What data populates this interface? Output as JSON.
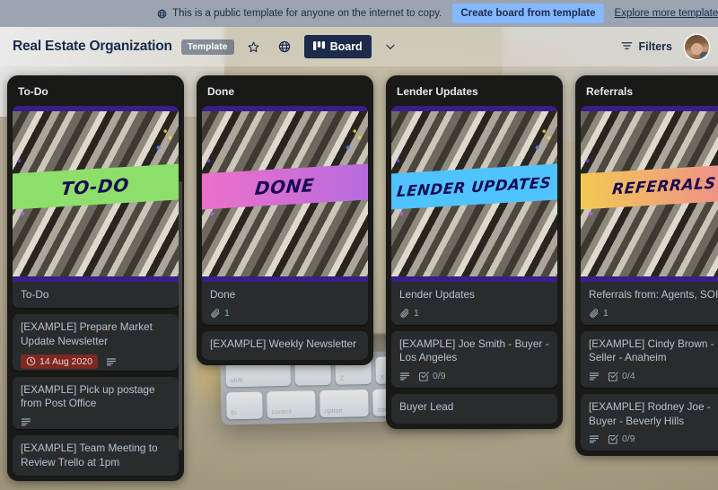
{
  "template_banner": {
    "globe_icon": "globe-icon",
    "message": "This is a public template for anyone on the internet to copy.",
    "cta_label": "Create board from template",
    "explore_label": "Explore more templates",
    "background_color": "#9aa5b1",
    "cta_color": "#85b8ff"
  },
  "board_header": {
    "title": "Real Estate Organization",
    "template_pill": "Template",
    "star_icon": "star-icon",
    "visibility_icon": "globe-icon",
    "view_button": {
      "icon": "board-icon",
      "label": "Board"
    },
    "view_caret_icon": "chevron-down-icon",
    "filters": {
      "icon": "filter-icon",
      "label": "Filters"
    },
    "avatar": "user-avatar"
  },
  "lists": [
    {
      "name": "To-Do",
      "cover_banner_text": "TO-DO",
      "banner_color_start": "#8ede6b",
      "banner_color_end": "#8ede6b",
      "cards": [
        {
          "has_cover": true,
          "title": "To-Do",
          "badges": [
            {
              "type": "attachment",
              "icon": "paperclip-icon",
              "value": "1"
            }
          ]
        },
        {
          "has_cover": false,
          "title": "[EXAMPLE] Prepare Market Update Newsletter",
          "badges": [
            {
              "type": "due-date",
              "icon": "clock-icon",
              "value": "14 Aug 2020"
            },
            {
              "type": "description",
              "icon": "description-icon",
              "value": ""
            }
          ]
        },
        {
          "has_cover": false,
          "title": "[EXAMPLE] Pick up postage from Post Office",
          "badges": [
            {
              "type": "description",
              "icon": "description-icon",
              "value": ""
            }
          ]
        },
        {
          "has_cover": false,
          "title": "[EXAMPLE] Team Meeting to Review Trello at 1pm",
          "badges": []
        }
      ]
    },
    {
      "name": "Done",
      "cover_banner_text": "DONE",
      "banner_color_start": "#f472c8",
      "banner_color_end": "#b06ae0",
      "cards": [
        {
          "has_cover": true,
          "title": "Done",
          "badges": [
            {
              "type": "attachment",
              "icon": "paperclip-icon",
              "value": "1"
            }
          ]
        },
        {
          "has_cover": false,
          "title": "[EXAMPLE] Weekly Newsletter",
          "badges": []
        }
      ]
    },
    {
      "name": "Lender Updates",
      "cover_banner_text": "LENDER UPDATES",
      "banner_color_start": "#4fc3ff",
      "banner_color_end": "#4fc3ff",
      "cards": [
        {
          "has_cover": true,
          "title": "Lender Updates",
          "badges": [
            {
              "type": "attachment",
              "icon": "paperclip-icon",
              "value": "1"
            }
          ]
        },
        {
          "has_cover": false,
          "title": "[EXAMPLE] Joe Smith - Buyer - Los Angeles",
          "badges": [
            {
              "type": "description",
              "icon": "description-icon",
              "value": ""
            },
            {
              "type": "checklist",
              "icon": "checklist-icon",
              "value": "0/9"
            }
          ]
        },
        {
          "has_cover": false,
          "title": "Buyer Lead",
          "badges": []
        }
      ]
    },
    {
      "name": "Referrals",
      "cover_banner_text": "REFERRALS",
      "banner_color_start": "#f2d24b",
      "banner_color_end": "#ef7f9b",
      "cards": [
        {
          "has_cover": true,
          "title": "Referrals from: Agents, SOI, etc",
          "badges": [
            {
              "type": "attachment",
              "icon": "paperclip-icon",
              "value": "1"
            }
          ]
        },
        {
          "has_cover": false,
          "title": "[EXAMPLE] Cindy Brown - Seller - Anaheim",
          "badges": [
            {
              "type": "description",
              "icon": "description-icon",
              "value": ""
            },
            {
              "type": "checklist",
              "icon": "checklist-icon",
              "value": "0/4"
            }
          ]
        },
        {
          "has_cover": false,
          "title": "[EXAMPLE] Rodney Joe - Buyer - Beverly Hills",
          "badges": [
            {
              "type": "description",
              "icon": "description-icon",
              "value": ""
            },
            {
              "type": "checklist",
              "icon": "checklist-icon",
              "value": "0/9"
            }
          ]
        }
      ]
    }
  ],
  "theme": {
    "list_background": "#191a17",
    "card_background": "#282c2e",
    "card_text": "#bdc1c6",
    "due_badge_background": "#7e2a21",
    "cover_frame": "#3b1d86"
  }
}
